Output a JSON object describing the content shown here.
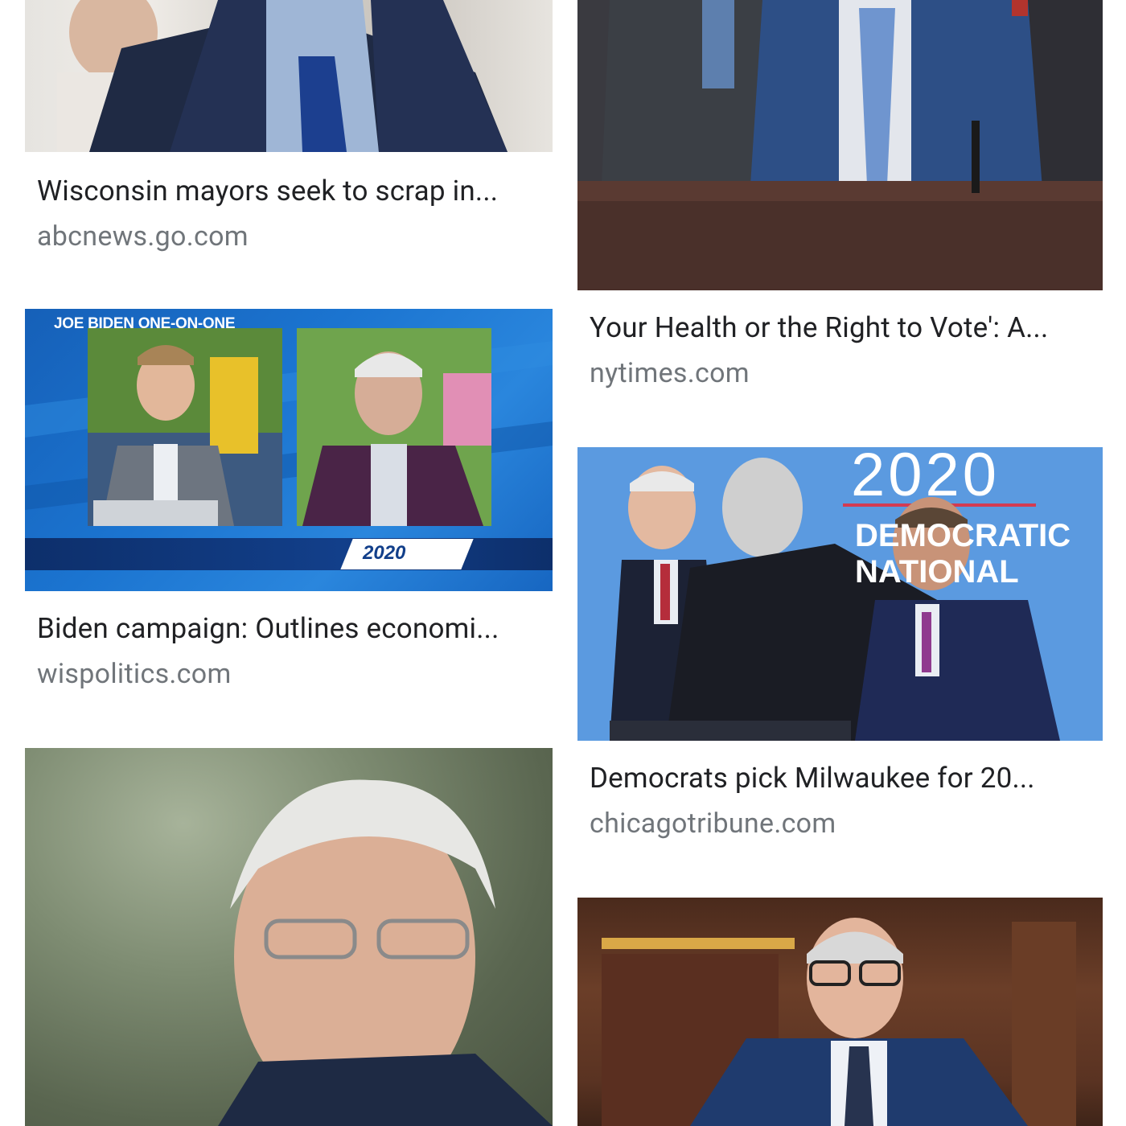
{
  "results": [
    {
      "id": "abc",
      "title": "Wisconsin mayors seek to scrap in...",
      "source": "abcnews.go.com"
    },
    {
      "id": "nyt",
      "title": "Your Health or the Right to Vote': A...",
      "source": "nytimes.com"
    },
    {
      "id": "wis",
      "title": "Biden campaign: Outlines economi...",
      "source": "wispolitics.com",
      "overlay": {
        "lower_third": "JOE BIDEN ONE-ON-ONE",
        "badge": "2020"
      }
    },
    {
      "id": "chi",
      "title": "Democrats pick Milwaukee for 20...",
      "source": "chicagotribune.com",
      "overlay": {
        "backdrop_year": "2020",
        "backdrop_word": "DEMOCRATIC NATIONAL"
      }
    }
  ]
}
